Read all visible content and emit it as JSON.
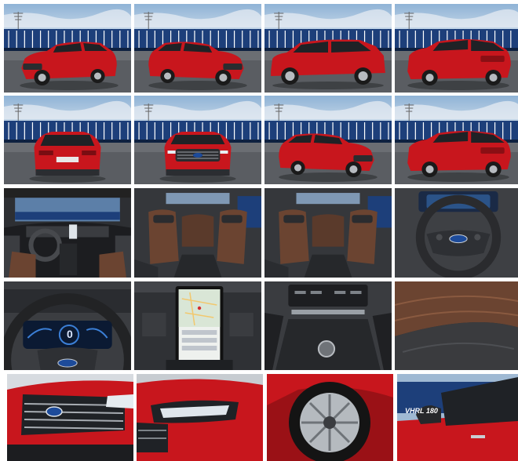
{
  "gallery": {
    "rows": [
      [
        {
          "name": "exterior-front-three-quarter-left",
          "view": "front-3q-left"
        },
        {
          "name": "exterior-front-three-quarter-right",
          "view": "front-3q-right"
        },
        {
          "name": "exterior-side-profile",
          "view": "side"
        },
        {
          "name": "exterior-rear-three-quarter",
          "view": "rear-3q"
        }
      ],
      [
        {
          "name": "exterior-rear",
          "view": "rear"
        },
        {
          "name": "exterior-front",
          "view": "front"
        },
        {
          "name": "exterior-front-three-quarter-low",
          "view": "front-3q-right"
        },
        {
          "name": "exterior-rear-three-quarter-right",
          "view": "rear-3q"
        }
      ],
      [
        {
          "name": "interior-dashboard",
          "view": "dashboard"
        },
        {
          "name": "interior-seats-rear-view",
          "view": "seats"
        },
        {
          "name": "interior-seats-side-view",
          "view": "seats"
        },
        {
          "name": "interior-steering-wheel",
          "view": "steering"
        }
      ],
      [
        {
          "name": "interior-instrument-cluster",
          "view": "cluster"
        },
        {
          "name": "interior-touchscreen",
          "view": "touchscreen"
        },
        {
          "name": "interior-center-console",
          "view": "console"
        },
        {
          "name": "interior-seat-detail",
          "view": "seat-detail"
        }
      ],
      [
        {
          "name": "detail-grille",
          "view": "grille"
        },
        {
          "name": "detail-headlight",
          "view": "headlight"
        },
        {
          "name": "detail-wheel",
          "view": "wheel"
        },
        {
          "name": "detail-side-mirror",
          "view": "mirror"
        }
      ]
    ],
    "cluster_speed": "0",
    "railcar_text": "VHRL 180"
  },
  "colors": {
    "body": "#c8161d",
    "sky": "#a9c4df",
    "train": "#1d3f7a",
    "asphalt": "#5a5d62",
    "leather": "#6b4431",
    "dark": "#1c1d20"
  }
}
